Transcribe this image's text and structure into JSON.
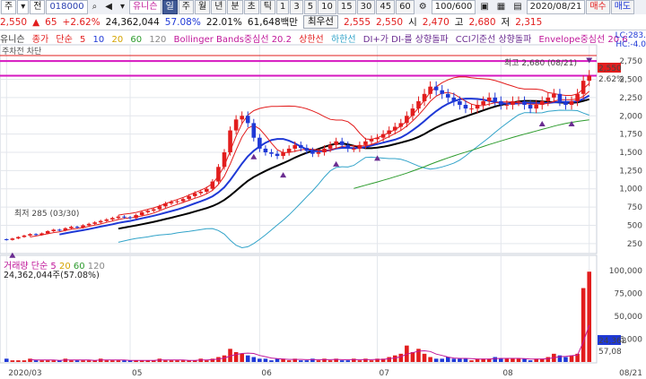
{
  "toolbar": {
    "items": [
      "주",
      "▾",
      "전",
      "",
      "U18000",
      "",
      "",
      "",
      "",
      "",
      "유니슨",
      "",
      "일",
      "주",
      "월",
      "년",
      "분",
      "초",
      "틱",
      "1",
      "3",
      "5",
      "10",
      "15",
      "30",
      "45",
      "60",
      "",
      "100/600",
      "",
      "",
      "",
      "",
      "",
      "",
      "",
      "2020/08/21",
      "",
      "매수",
      "매도"
    ],
    "interval_day": "일",
    "interval_week": "주",
    "interval_month": "월",
    "interval_year": "년",
    "interval_min": "분",
    "interval_sec": "초",
    "interval_tick": "틱",
    "minutes": [
      "1",
      "3",
      "5",
      "10",
      "15",
      "30",
      "45",
      "60"
    ],
    "count": "100/600",
    "date": "2020/08/21",
    "buy_label": "매수",
    "sell_label": "매도",
    "code": "018000",
    "stock_name": "유니슨",
    "type_label": "주",
    "prev_label": "전"
  },
  "price_line": {
    "price": "2,550",
    "change_arrow": "▲",
    "change": "65",
    "change_pct": "+2.62%",
    "volume": "24,362,044",
    "ratio1": "57.08%",
    "ratio2": "22.01%",
    "amount": "61,648백만",
    "best_label": "최우선",
    "best_sell": "2,555",
    "best_buy": "2,550",
    "open_label": "시",
    "open": "2,470",
    "high_label": "고",
    "high": "2,680",
    "low_label": "저",
    "low": "2,315"
  },
  "legend": {
    "name": "유니슨",
    "close": "종가",
    "sma": "단순",
    "ma5": "5",
    "ma10": "10",
    "ma20": "20",
    "ma60": "60",
    "ma120": "120",
    "bollinger": "Bollinger Bands중심선 20.2",
    "upper": "상한선",
    "lower": "하한선",
    "dmi": "DI+가 DI-를 상향돌파",
    "cci": "CCI기준선 상향돌파",
    "envelope": "Envelope중심선 20.6",
    "lc": "LC:283.",
    "hc": "HC:-4.0"
  },
  "sub_legend": "주차전 차단",
  "annotations": {
    "high": "최고 2,680 (08/21)",
    "low": "최저 285 (03/30)"
  },
  "price_axis": {
    "ticks": [
      "2,750",
      "2,500",
      "2,250",
      "2,000",
      "1,750",
      "1,500",
      "1,250",
      "1,000",
      "750",
      "500",
      "250"
    ],
    "current": "2,550",
    "current_pct": "2.62%"
  },
  "volume_legend": {
    "name": "거래량",
    "sma": "단순",
    "ma5": "5",
    "ma20": "20",
    "ma60": "60",
    "ma120": "120",
    "value": "24,362,044주(57.08%)"
  },
  "volume_axis": {
    "ticks": [
      "100,000",
      "75,000",
      "50,000",
      "25,000"
    ],
    "current": "24,362",
    "ratio": "57,08"
  },
  "x_axis": {
    "labels": [
      "2020/03",
      "05",
      "06",
      "07",
      "08",
      "08/21"
    ]
  },
  "colors": {
    "up": "#e21d1d",
    "down": "#1f39d6",
    "ma5": "#e21d1d",
    "ma10": "#1f39d6",
    "ma20": "#000000",
    "ma60": "#2c9b2c",
    "ma120": "#888888",
    "bollinger_upper": "#e21d1d",
    "bollinger_lower": "#31a3c9",
    "signal": "#6a2c91",
    "hline": "#d617c0"
  },
  "chart_data": {
    "type": "candlestick",
    "price": {
      "x": [
        "2020/03",
        "",
        "",
        "",
        "",
        "",
        "",
        "",
        "",
        "",
        "",
        "",
        "",
        "",
        "",
        "",
        "",
        "",
        "",
        "",
        "",
        "",
        "",
        "",
        "",
        "",
        "",
        "",
        "",
        "",
        "",
        "",
        "",
        "",
        "",
        "",
        "",
        "",
        "",
        "",
        "",
        "",
        "",
        "",
        "",
        "",
        "",
        "",
        "",
        "",
        "",
        "",
        "",
        "",
        "",
        "",
        "",
        "",
        "",
        "",
        "",
        "",
        "",
        "",
        "",
        "",
        "",
        "",
        "",
        "",
        "",
        "",
        "",
        "",
        "",
        "",
        "",
        "",
        "",
        "",
        "",
        "",
        "",
        "",
        "",
        "",
        "",
        "",
        "",
        "",
        "",
        "",
        "",
        "",
        "",
        "",
        "",
        "",
        "",
        "",
        "08/21"
      ],
      "open": [
        310,
        300,
        320,
        340,
        360,
        380,
        370,
        390,
        420,
        440,
        430,
        460,
        480,
        470,
        500,
        520,
        540,
        560,
        580,
        600,
        620,
        610,
        600,
        640,
        680,
        700,
        720,
        760,
        800,
        820,
        830,
        860,
        900,
        940,
        960,
        1000,
        1100,
        1300,
        1500,
        1800,
        1950,
        2000,
        1900,
        1700,
        1550,
        1500,
        1480,
        1450,
        1500,
        1550,
        1600,
        1560,
        1520,
        1480,
        1500,
        1550,
        1600,
        1650,
        1600,
        1550,
        1550,
        1600,
        1650,
        1680,
        1700,
        1750,
        1800,
        1850,
        1900,
        2000,
        2100,
        2200,
        2300,
        2400,
        2350,
        2300,
        2250,
        2200,
        2150,
        2100,
        2100,
        2150,
        2200,
        2250,
        2200,
        2150,
        2150,
        2200,
        2200,
        2150,
        2100,
        2150,
        2200,
        2250,
        2300,
        2200,
        2150,
        2200,
        2300,
        2480
      ],
      "close": [
        300,
        320,
        340,
        360,
        380,
        370,
        390,
        420,
        440,
        430,
        460,
        480,
        470,
        500,
        520,
        540,
        560,
        580,
        600,
        620,
        610,
        600,
        640,
        680,
        700,
        720,
        760,
        800,
        820,
        830,
        860,
        900,
        940,
        960,
        1000,
        1100,
        1300,
        1500,
        1800,
        1950,
        2000,
        1900,
        1700,
        1550,
        1500,
        1480,
        1450,
        1500,
        1550,
        1600,
        1560,
        1520,
        1480,
        1500,
        1550,
        1600,
        1650,
        1600,
        1550,
        1550,
        1600,
        1650,
        1680,
        1700,
        1750,
        1800,
        1850,
        1900,
        2000,
        2100,
        2200,
        2300,
        2400,
        2350,
        2300,
        2250,
        2200,
        2150,
        2100,
        2100,
        2150,
        2200,
        2250,
        2200,
        2150,
        2150,
        2200,
        2200,
        2150,
        2100,
        2150,
        2200,
        2250,
        2300,
        2200,
        2150,
        2200,
        2300,
        2480,
        2550
      ]
    },
    "volume": {
      "values": [
        2,
        1,
        1,
        1,
        2,
        1,
        1,
        1,
        1,
        1,
        2,
        1,
        1,
        1,
        1,
        1,
        2,
        1,
        1,
        1,
        1,
        1,
        1,
        1,
        1,
        1,
        2,
        1,
        1,
        1,
        1,
        1,
        1,
        2,
        1,
        2,
        3,
        4,
        8,
        6,
        5,
        4,
        3,
        2,
        2,
        1,
        2,
        2,
        1,
        2,
        1,
        1,
        2,
        1,
        2,
        1,
        2,
        1,
        1,
        2,
        1,
        2,
        1,
        2,
        2,
        3,
        4,
        5,
        10,
        6,
        8,
        5,
        3,
        2,
        2,
        3,
        2,
        2,
        2,
        1,
        2,
        2,
        2,
        3,
        2,
        2,
        2,
        2,
        2,
        1,
        2,
        2,
        3,
        5,
        4,
        3,
        4,
        5,
        45,
        55
      ],
      "unit": "천주",
      "ylim": [
        0,
        110000
      ]
    },
    "ylim": [
      150,
      2850
    ]
  }
}
